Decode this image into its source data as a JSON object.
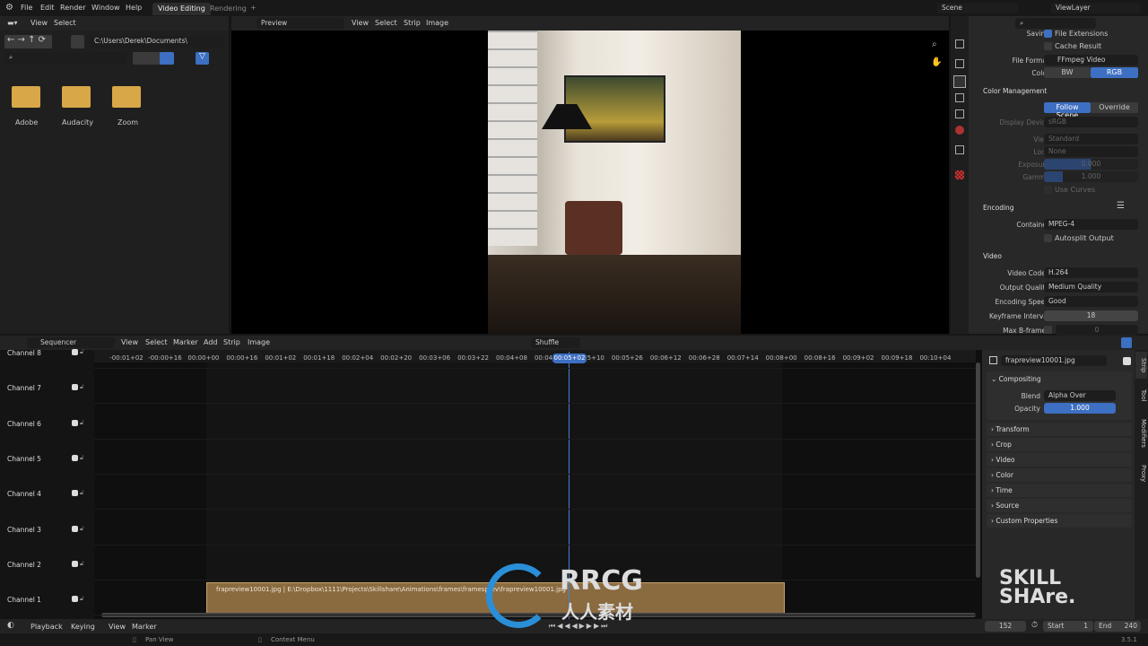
{
  "topbar": {
    "menus": [
      "File",
      "Edit",
      "Render",
      "Window",
      "Help"
    ],
    "workspaces": [
      "Video Editing",
      "Rendering"
    ],
    "add": "+",
    "scene": "Scene",
    "view_layer": "ViewLayer"
  },
  "file_browser": {
    "menus": [
      "View",
      "Select"
    ],
    "path": "C:\\Users\\Derek\\Documents\\",
    "folders": [
      "Adobe",
      "Audacity",
      "Zoom"
    ]
  },
  "preview": {
    "mode": "Preview",
    "menus": [
      "View",
      "Select",
      "Strip",
      "Image"
    ]
  },
  "properties": {
    "saving_label": "Saving",
    "file_extensions": "File Extensions",
    "cache_result": "Cache Result",
    "file_format_label": "File Format",
    "file_format": "FFmpeg Video",
    "color_label": "Color",
    "color_options": [
      "BW",
      "RGB"
    ],
    "color_selected": "RGB",
    "color_management": "Color Management",
    "cm_options": [
      "Follow Scene",
      "Override"
    ],
    "display_device_label": "Display Device",
    "display_device": "sRGB",
    "view_label": "View",
    "view": "Standard",
    "look_label": "Look",
    "look": "None",
    "exposure_label": "Exposure",
    "exposure": "0.000",
    "gamma_label": "Gamma",
    "gamma": "1.000",
    "use_curves": "Use Curves",
    "encoding": "Encoding",
    "container_label": "Container",
    "container": "MPEG-4",
    "autosplit": "Autosplit Output",
    "video": "Video",
    "codec_label": "Video Codec",
    "codec": "H.264",
    "quality_label": "Output Quality",
    "quality": "Medium Quality",
    "speed_label": "Encoding Speed",
    "speed": "Good",
    "keyframe_label": "Keyframe Interval",
    "keyframe": "18",
    "bframes_label": "Max B-frames",
    "bframes": "0"
  },
  "sequencer": {
    "editor": "Sequencer",
    "menus": [
      "View",
      "Select",
      "Marker",
      "Add",
      "Strip",
      "Image"
    ],
    "overlap": "Shuffle",
    "channels": [
      "Channel 8",
      "Channel 7",
      "Channel 6",
      "Channel 5",
      "Channel 4",
      "Channel 3",
      "Channel 2",
      "Channel 1"
    ],
    "timecodes": [
      "-00:01+02",
      "-00:00+16",
      "00:00+00",
      "00:00+16",
      "00:01+02",
      "00:01+18",
      "00:02+04",
      "00:02+20",
      "00:03+06",
      "00:03+22",
      "00:04+08",
      "00:04+24",
      "00:05+10",
      "00:05+26",
      "00:06+12",
      "00:06+28",
      "00:07+14",
      "00:08+00",
      "00:08+16",
      "00:09+02",
      "00:09+18",
      "00:10+04"
    ],
    "playhead": "00:05+02",
    "strip": "frapreview10001.jpg | E:\\Dropbox\\1111\\Projects\\Skillshare\\Animations\\frames\\framesprev\\frapreview10001.jpg",
    "strip_color": "#8a6a3f"
  },
  "strip_panel": {
    "name": "frapreview10001.jpg",
    "compositing": "Compositing",
    "blend_label": "Blend",
    "blend": "Alpha Over",
    "opacity_label": "Opacity",
    "opacity": "1.000",
    "sections": [
      "Transform",
      "Crop",
      "Video",
      "Color",
      "Time",
      "Source",
      "Custom Properties"
    ],
    "tabs": [
      "Strip",
      "Tool",
      "Modifiers",
      "Proxy"
    ]
  },
  "timeline": {
    "menus": [
      "Playback",
      "Keying",
      "View",
      "Marker"
    ],
    "frame": "152",
    "start_label": "Start",
    "start": "1",
    "end_label": "End",
    "end": "240"
  },
  "statusbar": {
    "pan": "Pan View",
    "context": "Context Menu",
    "version": "3.5.1"
  },
  "watermarks": {
    "skillshare": "SKILL SHARE.",
    "rrcg": "RRCG 人人素材"
  },
  "colors": {
    "accent": "#3d6fc2",
    "strip": "#8a6a3f"
  }
}
